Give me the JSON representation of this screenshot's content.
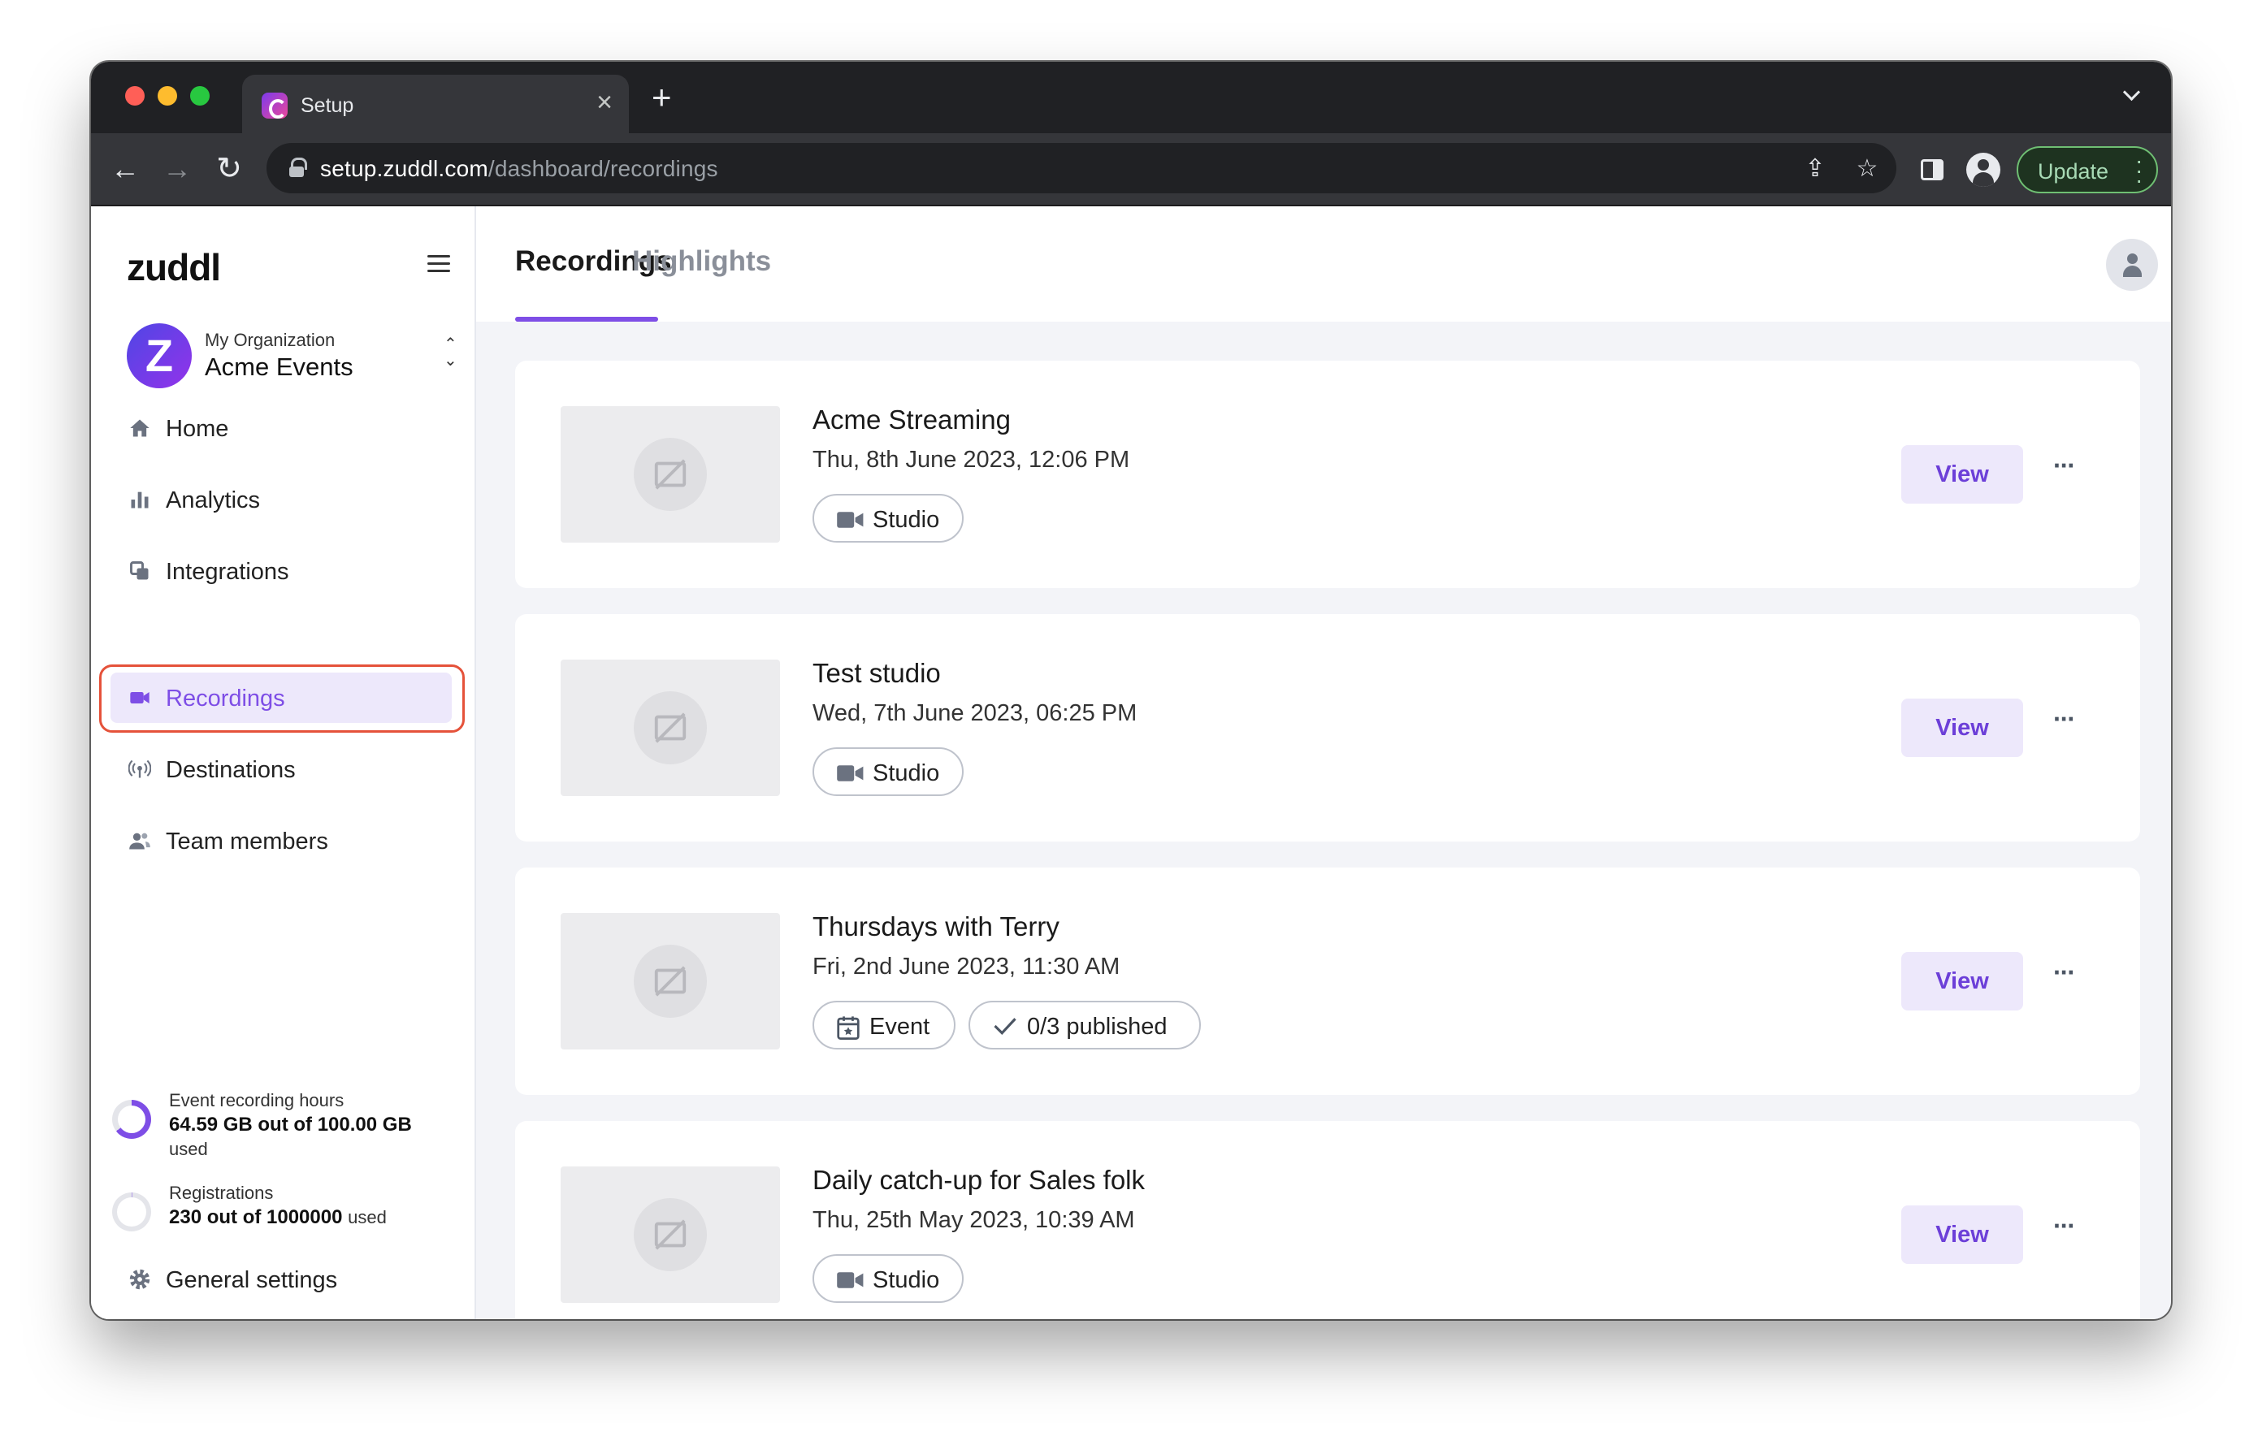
{
  "browser": {
    "tab_title": "Setup",
    "url_host": "setup.zuddl.com",
    "url_path": "/dashboard/recordings",
    "update_label": "Update"
  },
  "sidebar": {
    "logo": "zuddl",
    "org": {
      "kicker": "My Organization",
      "name": "Acme Events",
      "avatar_letter": "Z"
    },
    "items": [
      {
        "label": "Home",
        "icon": "home-icon",
        "active": false
      },
      {
        "label": "Analytics",
        "icon": "bar-chart-icon",
        "active": false
      },
      {
        "label": "Integrations",
        "icon": "integrations-icon",
        "active": false
      },
      {
        "label": "Recordings",
        "icon": "video-camera-icon",
        "active": true
      },
      {
        "label": "Destinations",
        "icon": "broadcast-icon",
        "active": false
      },
      {
        "label": "Team members",
        "icon": "people-icon",
        "active": false
      }
    ],
    "usage": [
      {
        "title": "Event recording hours",
        "value": "64.59 GB out of 100.00 GB",
        "suffix": "used",
        "progress": 0.6459
      },
      {
        "title": "Registrations",
        "value": "230 out of 1000000",
        "suffix": "used",
        "progress": 0.00023
      }
    ],
    "settings_label": "General settings"
  },
  "main": {
    "tabs": [
      {
        "label": "Recordings",
        "active": true
      },
      {
        "label": "Highlights",
        "active": false
      }
    ],
    "recordings": [
      {
        "title": "Acme Streaming",
        "date": "Thu, 8th June 2023, 12:06 PM",
        "chips": [
          {
            "label": "Studio",
            "icon": "video-camera-icon"
          }
        ],
        "action": "View"
      },
      {
        "title": "Test studio",
        "date": "Wed, 7th June 2023, 06:25 PM",
        "chips": [
          {
            "label": "Studio",
            "icon": "video-camera-icon"
          }
        ],
        "action": "View"
      },
      {
        "title": "Thursdays with Terry",
        "date": "Fri, 2nd June 2023, 11:30 AM",
        "chips": [
          {
            "label": "Event",
            "icon": "calendar-icon"
          },
          {
            "label": "0/3 published",
            "icon": "check-icon"
          }
        ],
        "action": "View"
      },
      {
        "title": "Daily catch-up for Sales folk",
        "date": "Thu, 25th May 2023, 10:39 AM",
        "chips": [
          {
            "label": "Studio",
            "icon": "video-camera-icon"
          }
        ],
        "action": "View"
      }
    ]
  },
  "colors": {
    "accent": "#7e4ee6",
    "accent_soft": "#ede8fb",
    "highlight_outline": "#e5523a",
    "update_green": "#6fbf73"
  }
}
